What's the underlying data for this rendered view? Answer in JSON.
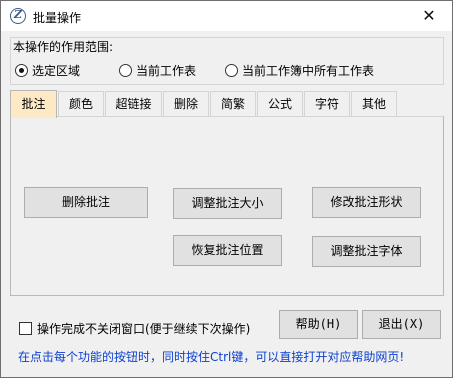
{
  "window": {
    "title": "批量操作",
    "close_glyph": "✕"
  },
  "scope": {
    "label": "本操作的作用范围:",
    "options": [
      {
        "label": "选定区域",
        "selected": true
      },
      {
        "label": "当前工作表",
        "selected": false
      },
      {
        "label": "当前工作簿中所有工作表",
        "selected": false
      }
    ]
  },
  "tabs": [
    {
      "label": "批注",
      "active": true
    },
    {
      "label": "颜色",
      "active": false
    },
    {
      "label": "超链接",
      "active": false
    },
    {
      "label": "删除",
      "active": false
    },
    {
      "label": "简繁",
      "active": false
    },
    {
      "label": "公式",
      "active": false
    },
    {
      "label": "字符",
      "active": false
    },
    {
      "label": "其他",
      "active": false
    }
  ],
  "comment_panel": {
    "delete_comments": "删除批注",
    "resize_comments": "调整批注大小",
    "change_comment_shape": "修改批注形状",
    "restore_comment_position": "恢复批注位置",
    "adjust_comment_font": "调整批注字体"
  },
  "footer": {
    "keep_open_label": "操作完成不关闭窗口(便于继续下次操作)",
    "keep_open_checked": false,
    "help_label": "帮助(H)",
    "exit_label": "退出(X)",
    "hint": "在点击每个功能的按钮时，同时按住Ctrl键，可以直接打开对应帮助网页!"
  },
  "colors": {
    "active_tab": "#fde9c4",
    "hint_text": "#0b3fd1"
  }
}
